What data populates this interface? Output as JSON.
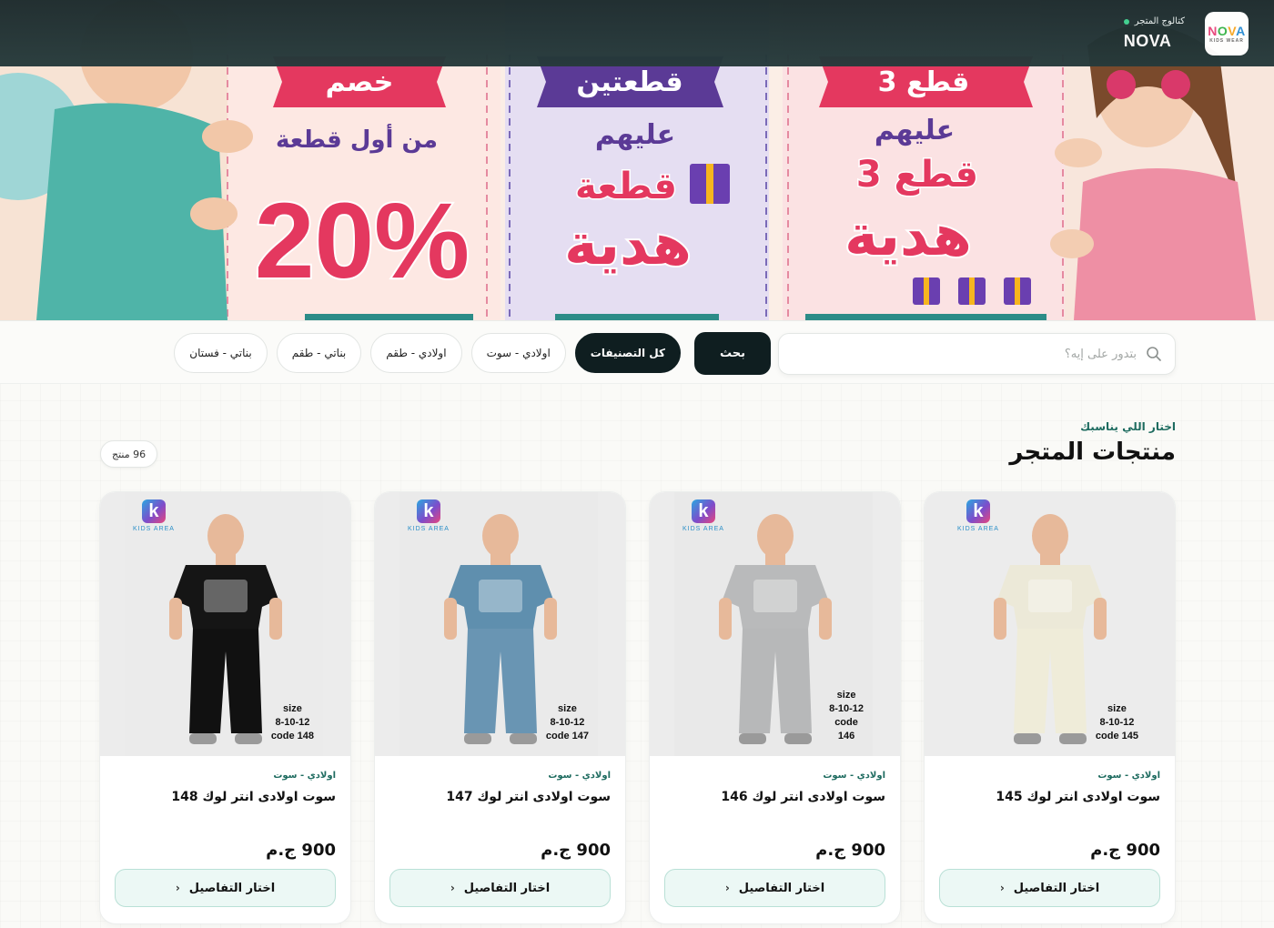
{
  "header": {
    "brand_name": "NOVA",
    "brand_subtitle": "كتالوج المتجر",
    "logo_text": "NOVA",
    "logo_sub": "KIDS WEAR"
  },
  "banner": {
    "left_panel": {
      "tag": "خصم",
      "line": "من أول قطعة",
      "big": "20%"
    },
    "middle_panel": {
      "tag": "قطعتين",
      "line": "عليهم",
      "gift1": "قطعة",
      "gift2": "هدية"
    },
    "right_panel": {
      "tag": "3 قطع",
      "line": "عليهم",
      "gift1": "3 قطع",
      "gift2": "هدية"
    }
  },
  "search": {
    "placeholder": "بتدور على إيه؟",
    "button_label": "بحث"
  },
  "filters": [
    {
      "label": "كل التصنيفات",
      "active": true
    },
    {
      "label": "اولادي - سوت",
      "active": false
    },
    {
      "label": "اولادي - طقم",
      "active": false
    },
    {
      "label": "بناتي - طقم",
      "active": false
    },
    {
      "label": "بناتي - فستان",
      "active": false
    }
  ],
  "section": {
    "kicker": "اختار اللي يناسبك",
    "title": "منتجات المتجر",
    "count": "96 منتج"
  },
  "products": [
    {
      "image_brand": "KIDS AREA",
      "image_label": [
        "size",
        "8-10-12",
        "code 145"
      ],
      "category": "اولادي - سوت",
      "name": "سوت اولادى انتر لوك 145",
      "price": "900 ج.م",
      "button": "اختار التفاصيل",
      "shirt_color": "#ece9d8",
      "pants_color": "#efecd9",
      "bg_color": "#ececec"
    },
    {
      "image_brand": "KIDS AREA",
      "image_label": [
        "size",
        "8-10-12",
        "code",
        "146"
      ],
      "category": "اولادي - سوت",
      "name": "سوت اولادى انتر لوك 146",
      "price": "900 ج.م",
      "button": "اختار التفاصيل",
      "shirt_color": "#b9babb",
      "pants_color": "#b7b8b9",
      "bg_color": "#e9e9e9"
    },
    {
      "image_brand": "KIDS AREA",
      "image_label": [
        "size",
        "8-10-12",
        "code 147"
      ],
      "category": "اولادي - سوت",
      "name": "سوت اولادى انتر لوك 147",
      "price": "900 ج.م",
      "button": "اختار التفاصيل",
      "shirt_color": "#5f8fae",
      "pants_color": "#6995b3",
      "bg_color": "#eaeaea"
    },
    {
      "image_brand": "KIDS AREA",
      "image_label": [
        "size",
        "8-10-12",
        "code 148"
      ],
      "category": "اولادي - سوت",
      "name": "سوت اولادى انتر لوك 148",
      "price": "900 ج.م",
      "button": "اختار التفاصيل",
      "shirt_color": "#151515",
      "pants_color": "#111111",
      "bg_color": "#ebebeb"
    }
  ],
  "colors": {
    "dark": "#0f1e20",
    "accent_green": "#1d6b5f",
    "banner_pink": "#e8467c",
    "banner_purple": "#5b3a96"
  }
}
